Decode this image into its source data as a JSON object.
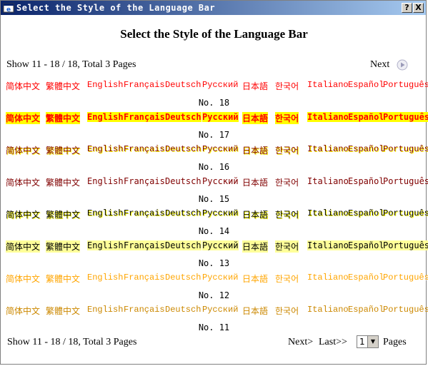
{
  "window": {
    "title": "Select the Style of the Language Bar",
    "help_label": "?",
    "close_label": "X"
  },
  "heading": "Select the Style of the Language Bar",
  "pager_top": {
    "info": "Show 11 - 18 / 18, Total 3 Pages",
    "next": "Next"
  },
  "languages": [
    "简体中文",
    "繁體中文",
    "English",
    "Français",
    "Deutsch",
    "Русский",
    "日本語",
    "한국어",
    "Italiano",
    "Español",
    "Português"
  ],
  "rows": [
    {
      "number": "No. 18"
    },
    {
      "number": "No. 17"
    },
    {
      "number": "No. 16"
    },
    {
      "number": "No. 15"
    },
    {
      "number": "No. 14"
    },
    {
      "number": "No. 13"
    },
    {
      "number": "No. 12"
    },
    {
      "number": "No. 11"
    }
  ],
  "pager_bottom": {
    "info": "Show 11 - 18 / 18, Total 3 Pages",
    "next": "Next>",
    "last": "Last>>",
    "page_select": "1",
    "pages_label": "Pages"
  },
  "colors": {
    "titlebar_start": "#0a246a",
    "titlebar_end": "#a6caf0"
  }
}
